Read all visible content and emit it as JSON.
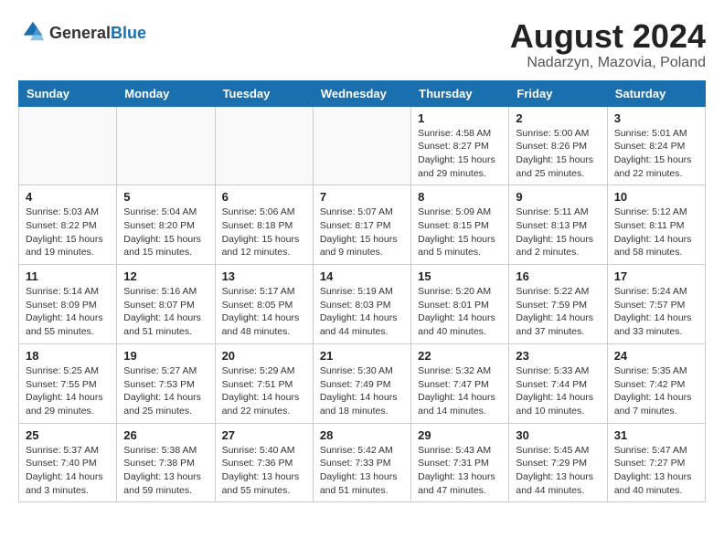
{
  "logo": {
    "general": "General",
    "blue": "Blue"
  },
  "title": "August 2024",
  "subtitle": "Nadarzyn, Mazovia, Poland",
  "weekdays": [
    "Sunday",
    "Monday",
    "Tuesday",
    "Wednesday",
    "Thursday",
    "Friday",
    "Saturday"
  ],
  "weeks": [
    [
      {
        "day": "",
        "info": ""
      },
      {
        "day": "",
        "info": ""
      },
      {
        "day": "",
        "info": ""
      },
      {
        "day": "",
        "info": ""
      },
      {
        "day": "1",
        "info": "Sunrise: 4:58 AM\nSunset: 8:27 PM\nDaylight: 15 hours\nand 29 minutes."
      },
      {
        "day": "2",
        "info": "Sunrise: 5:00 AM\nSunset: 8:26 PM\nDaylight: 15 hours\nand 25 minutes."
      },
      {
        "day": "3",
        "info": "Sunrise: 5:01 AM\nSunset: 8:24 PM\nDaylight: 15 hours\nand 22 minutes."
      }
    ],
    [
      {
        "day": "4",
        "info": "Sunrise: 5:03 AM\nSunset: 8:22 PM\nDaylight: 15 hours\nand 19 minutes."
      },
      {
        "day": "5",
        "info": "Sunrise: 5:04 AM\nSunset: 8:20 PM\nDaylight: 15 hours\nand 15 minutes."
      },
      {
        "day": "6",
        "info": "Sunrise: 5:06 AM\nSunset: 8:18 PM\nDaylight: 15 hours\nand 12 minutes."
      },
      {
        "day": "7",
        "info": "Sunrise: 5:07 AM\nSunset: 8:17 PM\nDaylight: 15 hours\nand 9 minutes."
      },
      {
        "day": "8",
        "info": "Sunrise: 5:09 AM\nSunset: 8:15 PM\nDaylight: 15 hours\nand 5 minutes."
      },
      {
        "day": "9",
        "info": "Sunrise: 5:11 AM\nSunset: 8:13 PM\nDaylight: 15 hours\nand 2 minutes."
      },
      {
        "day": "10",
        "info": "Sunrise: 5:12 AM\nSunset: 8:11 PM\nDaylight: 14 hours\nand 58 minutes."
      }
    ],
    [
      {
        "day": "11",
        "info": "Sunrise: 5:14 AM\nSunset: 8:09 PM\nDaylight: 14 hours\nand 55 minutes."
      },
      {
        "day": "12",
        "info": "Sunrise: 5:16 AM\nSunset: 8:07 PM\nDaylight: 14 hours\nand 51 minutes."
      },
      {
        "day": "13",
        "info": "Sunrise: 5:17 AM\nSunset: 8:05 PM\nDaylight: 14 hours\nand 48 minutes."
      },
      {
        "day": "14",
        "info": "Sunrise: 5:19 AM\nSunset: 8:03 PM\nDaylight: 14 hours\nand 44 minutes."
      },
      {
        "day": "15",
        "info": "Sunrise: 5:20 AM\nSunset: 8:01 PM\nDaylight: 14 hours\nand 40 minutes."
      },
      {
        "day": "16",
        "info": "Sunrise: 5:22 AM\nSunset: 7:59 PM\nDaylight: 14 hours\nand 37 minutes."
      },
      {
        "day": "17",
        "info": "Sunrise: 5:24 AM\nSunset: 7:57 PM\nDaylight: 14 hours\nand 33 minutes."
      }
    ],
    [
      {
        "day": "18",
        "info": "Sunrise: 5:25 AM\nSunset: 7:55 PM\nDaylight: 14 hours\nand 29 minutes."
      },
      {
        "day": "19",
        "info": "Sunrise: 5:27 AM\nSunset: 7:53 PM\nDaylight: 14 hours\nand 25 minutes."
      },
      {
        "day": "20",
        "info": "Sunrise: 5:29 AM\nSunset: 7:51 PM\nDaylight: 14 hours\nand 22 minutes."
      },
      {
        "day": "21",
        "info": "Sunrise: 5:30 AM\nSunset: 7:49 PM\nDaylight: 14 hours\nand 18 minutes."
      },
      {
        "day": "22",
        "info": "Sunrise: 5:32 AM\nSunset: 7:47 PM\nDaylight: 14 hours\nand 14 minutes."
      },
      {
        "day": "23",
        "info": "Sunrise: 5:33 AM\nSunset: 7:44 PM\nDaylight: 14 hours\nand 10 minutes."
      },
      {
        "day": "24",
        "info": "Sunrise: 5:35 AM\nSunset: 7:42 PM\nDaylight: 14 hours\nand 7 minutes."
      }
    ],
    [
      {
        "day": "25",
        "info": "Sunrise: 5:37 AM\nSunset: 7:40 PM\nDaylight: 14 hours\nand 3 minutes."
      },
      {
        "day": "26",
        "info": "Sunrise: 5:38 AM\nSunset: 7:38 PM\nDaylight: 13 hours\nand 59 minutes."
      },
      {
        "day": "27",
        "info": "Sunrise: 5:40 AM\nSunset: 7:36 PM\nDaylight: 13 hours\nand 55 minutes."
      },
      {
        "day": "28",
        "info": "Sunrise: 5:42 AM\nSunset: 7:33 PM\nDaylight: 13 hours\nand 51 minutes."
      },
      {
        "day": "29",
        "info": "Sunrise: 5:43 AM\nSunset: 7:31 PM\nDaylight: 13 hours\nand 47 minutes."
      },
      {
        "day": "30",
        "info": "Sunrise: 5:45 AM\nSunset: 7:29 PM\nDaylight: 13 hours\nand 44 minutes."
      },
      {
        "day": "31",
        "info": "Sunrise: 5:47 AM\nSunset: 7:27 PM\nDaylight: 13 hours\nand 40 minutes."
      }
    ]
  ]
}
